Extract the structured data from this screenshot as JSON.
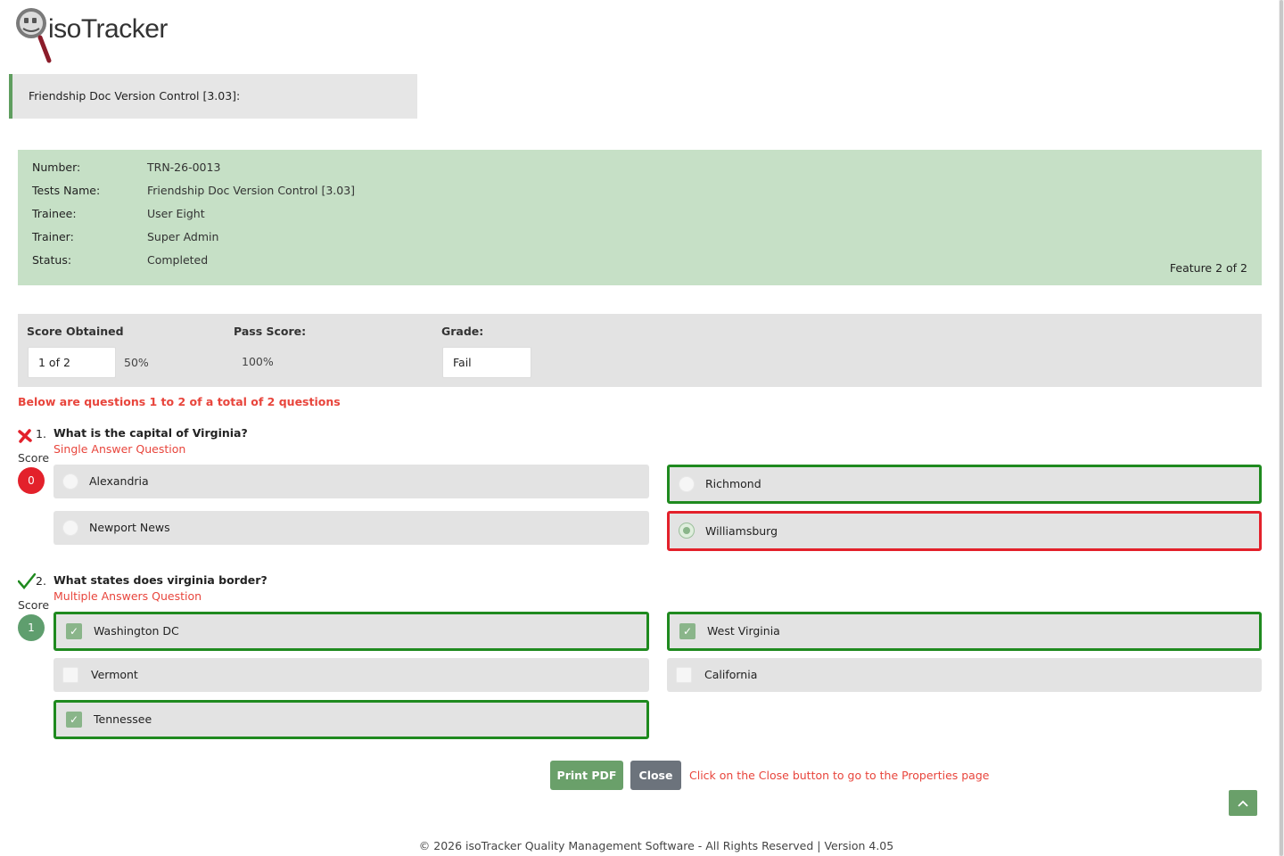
{
  "logo": {
    "text": "isoTracker",
    "icon": "magnifier-icon"
  },
  "title": "Friendship Doc Version Control [3.03]:",
  "info": {
    "rows": [
      {
        "label": "Number:",
        "value": "TRN-26-0013"
      },
      {
        "label": "Tests Name:",
        "value": "Friendship Doc Version Control [3.03]"
      },
      {
        "label": "Trainee:",
        "value": "User Eight"
      },
      {
        "label": "Trainer:",
        "value": "Super Admin"
      },
      {
        "label": "Status:",
        "value": "Completed"
      }
    ],
    "feature": "Feature 2 of 2"
  },
  "score": {
    "obtained_label": "Score Obtained",
    "obtained_value": "1 of 2",
    "percent": "50%",
    "pass_label": "Pass Score:",
    "pass_value": "100%",
    "grade_label": "Grade:",
    "grade_value": "Fail"
  },
  "questions_note": "Below are questions 1 to 2 of a total of 2 questions",
  "questions": [
    {
      "number": "1.",
      "text": "What is the capital of Virginia?",
      "type": "Single Answer Question",
      "result": "wrong",
      "score_caption": "Score",
      "score": "0",
      "options": [
        {
          "label": "Alexandria",
          "selected": false,
          "state": "none"
        },
        {
          "label": "Richmond",
          "selected": false,
          "state": "correct"
        },
        {
          "label": "Newport News",
          "selected": false,
          "state": "none"
        },
        {
          "label": "Williamsburg",
          "selected": true,
          "state": "wrong"
        }
      ]
    },
    {
      "number": "2.",
      "text": "What states does virginia border?",
      "type": "Multiple Answers Question",
      "result": "correct",
      "score_caption": "Score",
      "score": "1",
      "options": [
        {
          "label": "Washington DC",
          "selected": true,
          "state": "correct"
        },
        {
          "label": "West Virginia",
          "selected": true,
          "state": "correct"
        },
        {
          "label": "Vermont",
          "selected": false,
          "state": "none"
        },
        {
          "label": "California",
          "selected": false,
          "state": "none"
        },
        {
          "label": "Tennessee",
          "selected": true,
          "state": "correct"
        }
      ]
    }
  ],
  "buttons": {
    "print": "Print PDF",
    "close": "Close"
  },
  "close_note": "Click on the Close button to go to the Properties page",
  "footer": {
    "copyright": "© 2026 isoTracker Quality Management Software - All Rights Reserved | Version 4.05"
  },
  "colors": {
    "green": "#1f8a1f",
    "red": "#e3212b",
    "accent": "#6aa06a",
    "info_bg": "#c6e0c6"
  }
}
